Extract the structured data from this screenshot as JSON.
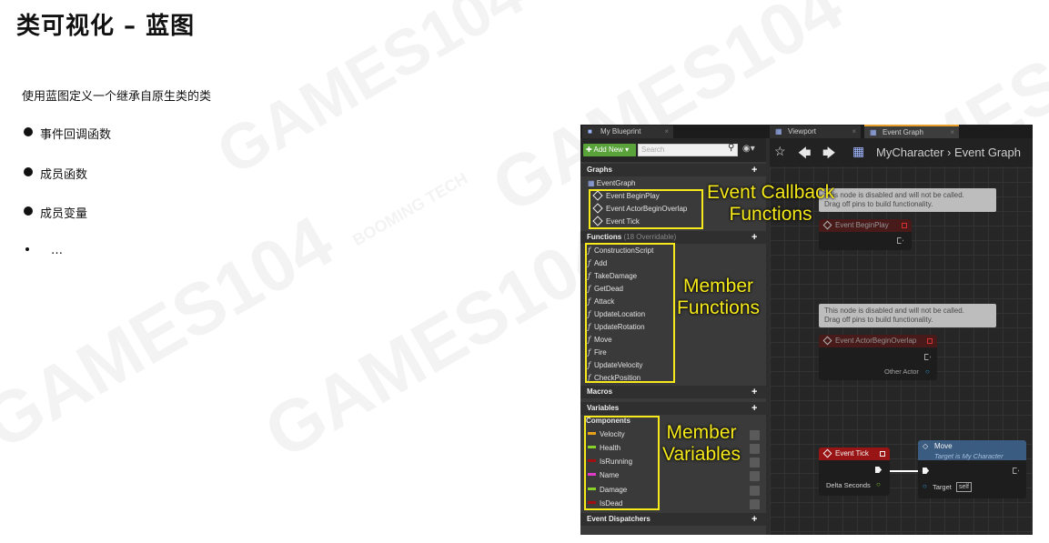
{
  "slide": {
    "title": "类可视化 – 蓝图",
    "subtitle": "使用蓝图定义一个继承自原生类的类",
    "bullets": [
      "事件回调函数",
      "成员函数",
      "成员变量",
      "…"
    ]
  },
  "watermark": {
    "texts": [
      "GAMES104",
      "GAMES104",
      "GAMES104",
      "GAMES104",
      "GAMES104"
    ],
    "booming": "BOOMING TECH"
  },
  "editor": {
    "tabs": {
      "my_blueprint": "My Blueprint",
      "viewport": "Viewport",
      "event_graph": "Event Graph"
    },
    "toolbar": {
      "add_new": "Add New ▾",
      "search_placeholder": "Search"
    },
    "graphs": {
      "header": "Graphs",
      "event_graph": "EventGraph",
      "events": [
        "Event BeginPlay",
        "Event ActorBeginOverlap",
        "Event Tick"
      ]
    },
    "functions": {
      "header": "Functions",
      "overridable": "(18 Overridable)",
      "items": [
        "ConstructionScript",
        "Add",
        "TakeDamage",
        "GetDead",
        "Attack",
        "UpdateLocation",
        "UpdateRotation",
        "Move",
        "Fire",
        "UpdateVelocity",
        "CheckPosition"
      ]
    },
    "macros": {
      "header": "Macros"
    },
    "variables": {
      "header": "Variables",
      "components": "Components",
      "items": [
        {
          "name": "Velocity",
          "color": "#e8a21a"
        },
        {
          "name": "Health",
          "color": "#8ad12a"
        },
        {
          "name": "IsRunning",
          "color": "#a01010"
        },
        {
          "name": "Name",
          "color": "#e03cc8"
        },
        {
          "name": "Damage",
          "color": "#8ad12a"
        },
        {
          "name": "IsDead",
          "color": "#a01010"
        }
      ]
    },
    "dispatchers": {
      "header": "Event Dispatchers"
    },
    "graph": {
      "breadcrumb": "MyCharacter  ›  Event Graph",
      "disabled_note_1": "This node is disabled and will not be called.",
      "disabled_note_2": "Drag off pins to build functionality.",
      "node_begin_play": "Event BeginPlay",
      "node_begin_overlap": "Event ActorBeginOverlap",
      "other_actor": "Other Actor",
      "node_tick": "Event Tick",
      "delta_seconds": "Delta Seconds",
      "node_move": "Move",
      "move_target": "Target is My Character",
      "target_label": "Target",
      "target_value": "self"
    }
  },
  "callouts": {
    "event_callback_1": "Event Callback",
    "event_callback_2": "Functions",
    "member_functions_1": "Member",
    "member_functions_2": "Functions",
    "member_variables_1": "Member",
    "member_variables_2": "Variables"
  },
  "colors": {
    "highlight": "#f7ea1a",
    "tick_header": "#a01515",
    "move_header": "#3d5f86",
    "add_new": "#5aa23a"
  }
}
